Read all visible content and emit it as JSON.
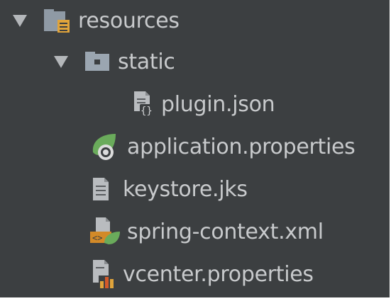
{
  "tree": {
    "items": [
      {
        "label": "resources",
        "icon": "resources-folder-icon",
        "expanded": true
      },
      {
        "label": "static",
        "icon": "folder-icon",
        "expanded": true
      },
      {
        "label": "plugin.json",
        "icon": "json-file-icon"
      },
      {
        "label": "application.properties",
        "icon": "spring-properties-icon"
      },
      {
        "label": "keystore.jks",
        "icon": "text-file-icon"
      },
      {
        "label": "spring-context.xml",
        "icon": "spring-xml-icon"
      },
      {
        "label": "vcenter.properties",
        "icon": "properties-file-icon"
      }
    ]
  },
  "colors": {
    "background": "#3c3f41",
    "text": "#c8cacc",
    "folder": "#a9b7c6",
    "spring_green": "#6aab5b",
    "properties_orange": "#d38a28"
  }
}
